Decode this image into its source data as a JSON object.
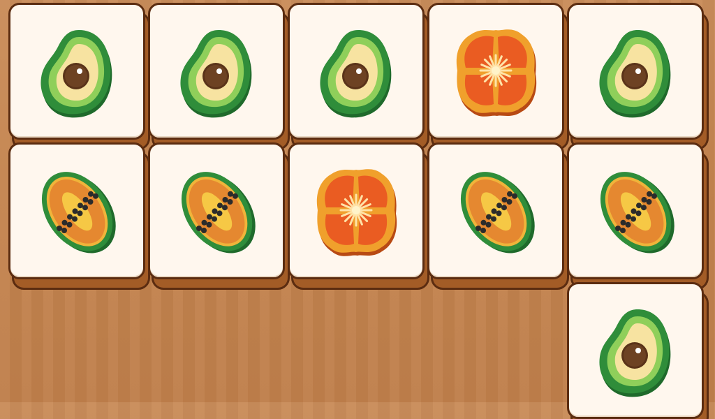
{
  "game": {
    "type": "tile-match",
    "colors": {
      "table": "#c4844f",
      "tile_face": "#fff7ee",
      "tile_side": "#a35c26",
      "tile_outline": "#5b2c10"
    },
    "tiles": [
      {
        "row": 0,
        "col": 0,
        "fruit": "avocado-icon"
      },
      {
        "row": 0,
        "col": 1,
        "fruit": "avocado-icon"
      },
      {
        "row": 0,
        "col": 2,
        "fruit": "avocado-icon"
      },
      {
        "row": 0,
        "col": 3,
        "fruit": "tomato-icon"
      },
      {
        "row": 0,
        "col": 4,
        "fruit": "avocado-icon"
      },
      {
        "row": 1,
        "col": 0,
        "fruit": "papaya-icon"
      },
      {
        "row": 1,
        "col": 1,
        "fruit": "papaya-icon"
      },
      {
        "row": 1,
        "col": 2,
        "fruit": "tomato-icon"
      },
      {
        "row": 1,
        "col": 3,
        "fruit": "papaya-icon"
      },
      {
        "row": 1,
        "col": 4,
        "fruit": "papaya-icon"
      },
      {
        "row": 2,
        "col": 4,
        "fruit": "avocado-icon"
      }
    ]
  }
}
